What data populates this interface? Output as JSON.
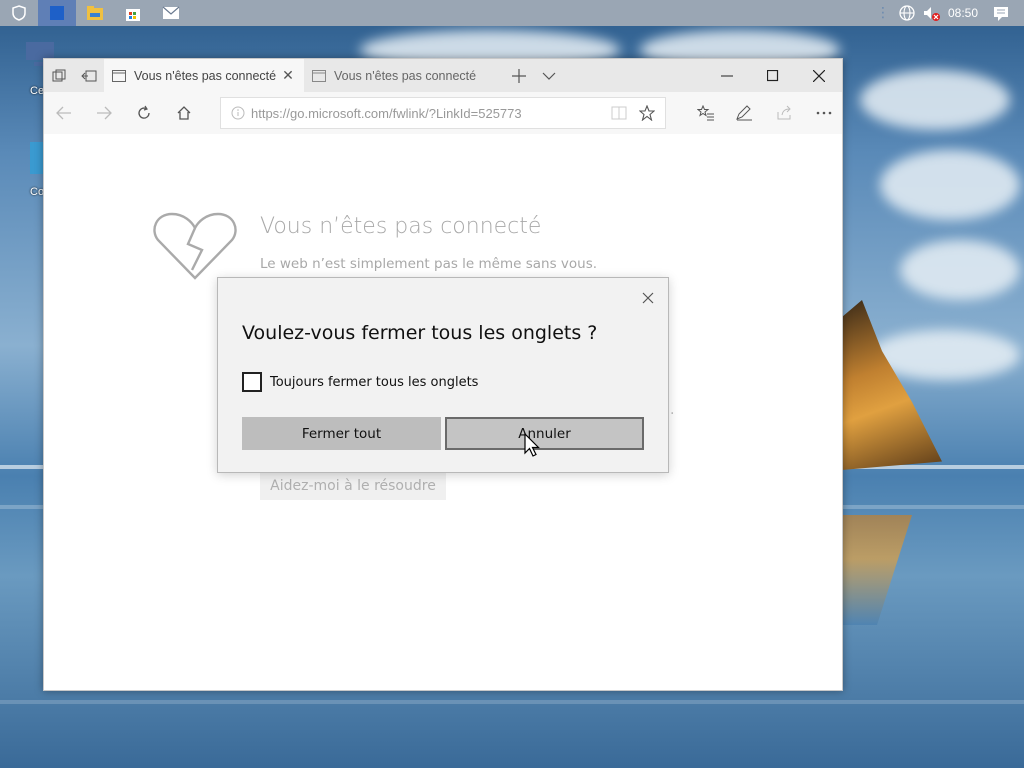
{
  "taskbar": {
    "clock": "08:50",
    "icons": [
      "shield-icon",
      "browser-icon",
      "file-explorer-icon",
      "store-icon",
      "mail-icon"
    ],
    "tray_icons": [
      "network-globe-icon",
      "volume-muted-icon",
      "notifications-icon"
    ]
  },
  "desktop": {
    "icons": [
      {
        "label": "Ce",
        "icon": "computer-icon"
      },
      {
        "label": "Cor",
        "icon": "recycle-bin-icon"
      }
    ]
  },
  "browser": {
    "tabs": [
      {
        "title": "Vous n'êtes pas connecté",
        "active": true
      },
      {
        "title": "Vous n'êtes pas connecté",
        "active": false
      }
    ],
    "address": "https://go.microsoft.com/fwlink/?LinkId=525773",
    "page": {
      "title": "Vous n’êtes pas connecté",
      "subtitle": "Le web n’est simplement pas le même sans vous.",
      "fragment": ".",
      "help_button": "Aidez-moi à le résoudre"
    }
  },
  "dialog": {
    "title": "Voulez-vous fermer tous les onglets ?",
    "checkbox_label": "Toujours fermer tous les onglets",
    "checkbox_checked": false,
    "primary_button": "Fermer tout",
    "secondary_button": "Annuler"
  },
  "colors": {
    "taskbar": "#9aa6b4",
    "taskbar_active": "#5f7fb6",
    "dialog_bg": "#f2f2f2",
    "button_bg": "#bdbdbd"
  }
}
